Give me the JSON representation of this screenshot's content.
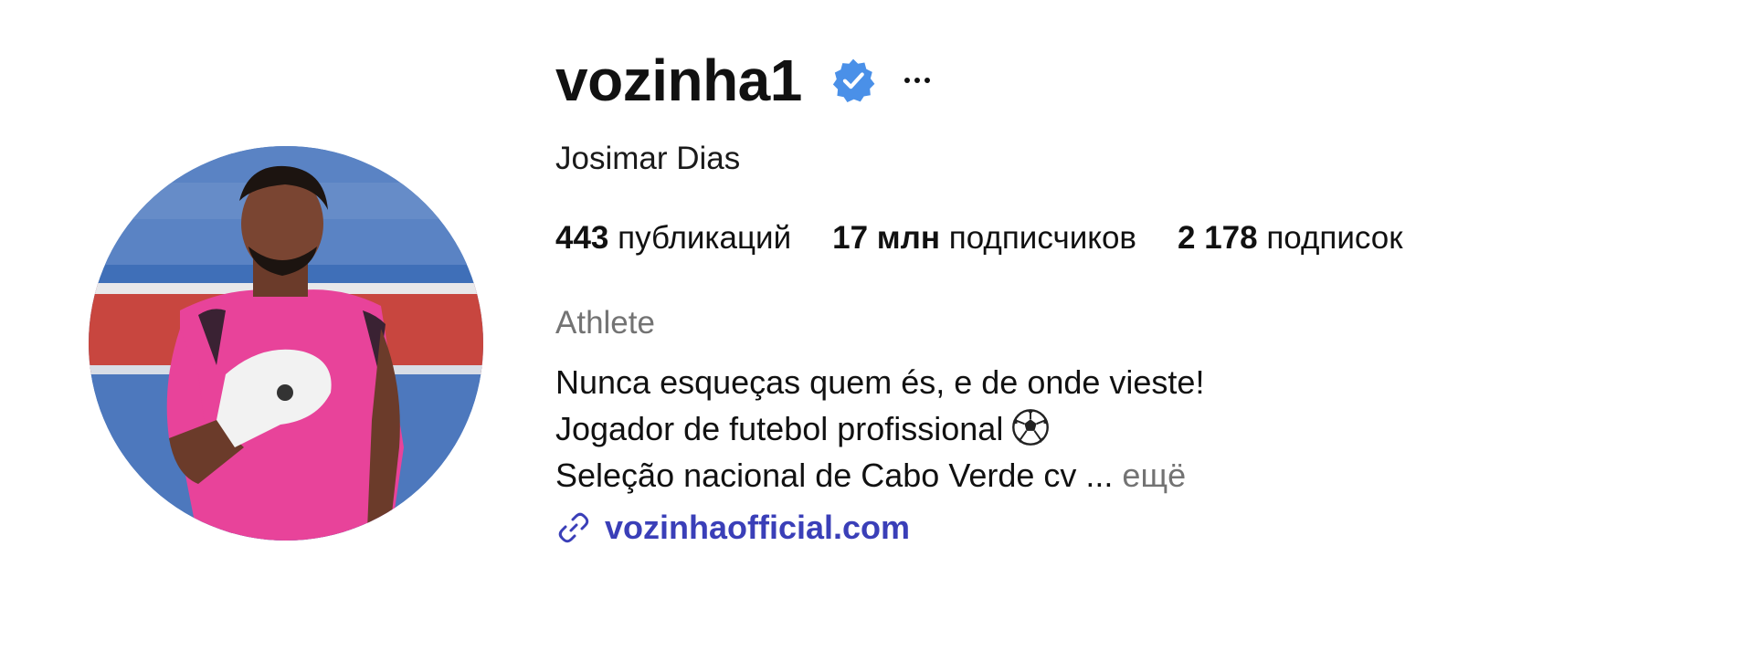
{
  "profile": {
    "username": "vozinha1",
    "full_name": "Josimar Dias",
    "verified_icon": "verified-badge-icon",
    "more_icon": "more-options-icon",
    "stats": [
      {
        "value": "443",
        "label": " публикаций"
      },
      {
        "value": "17 млн",
        "label": " подписчиков"
      },
      {
        "value": "2 178",
        "label": " подписок"
      }
    ],
    "category": "Athlete",
    "bio": {
      "line1": "Nunca esqueças quem és, e de onde vieste!",
      "line2": "Jogador de futebol profissional",
      "line2_icon": "soccer-ball-icon",
      "line3": "Seleção nacional de Cabo Verde cv ...",
      "more_label": "ещё"
    },
    "website": "vozinhaofficial.com",
    "website_icon": "link-icon"
  },
  "colors": {
    "verified": "#4a90e8",
    "link": "#3a3fb8",
    "muted": "#737373",
    "text": "#111111"
  }
}
